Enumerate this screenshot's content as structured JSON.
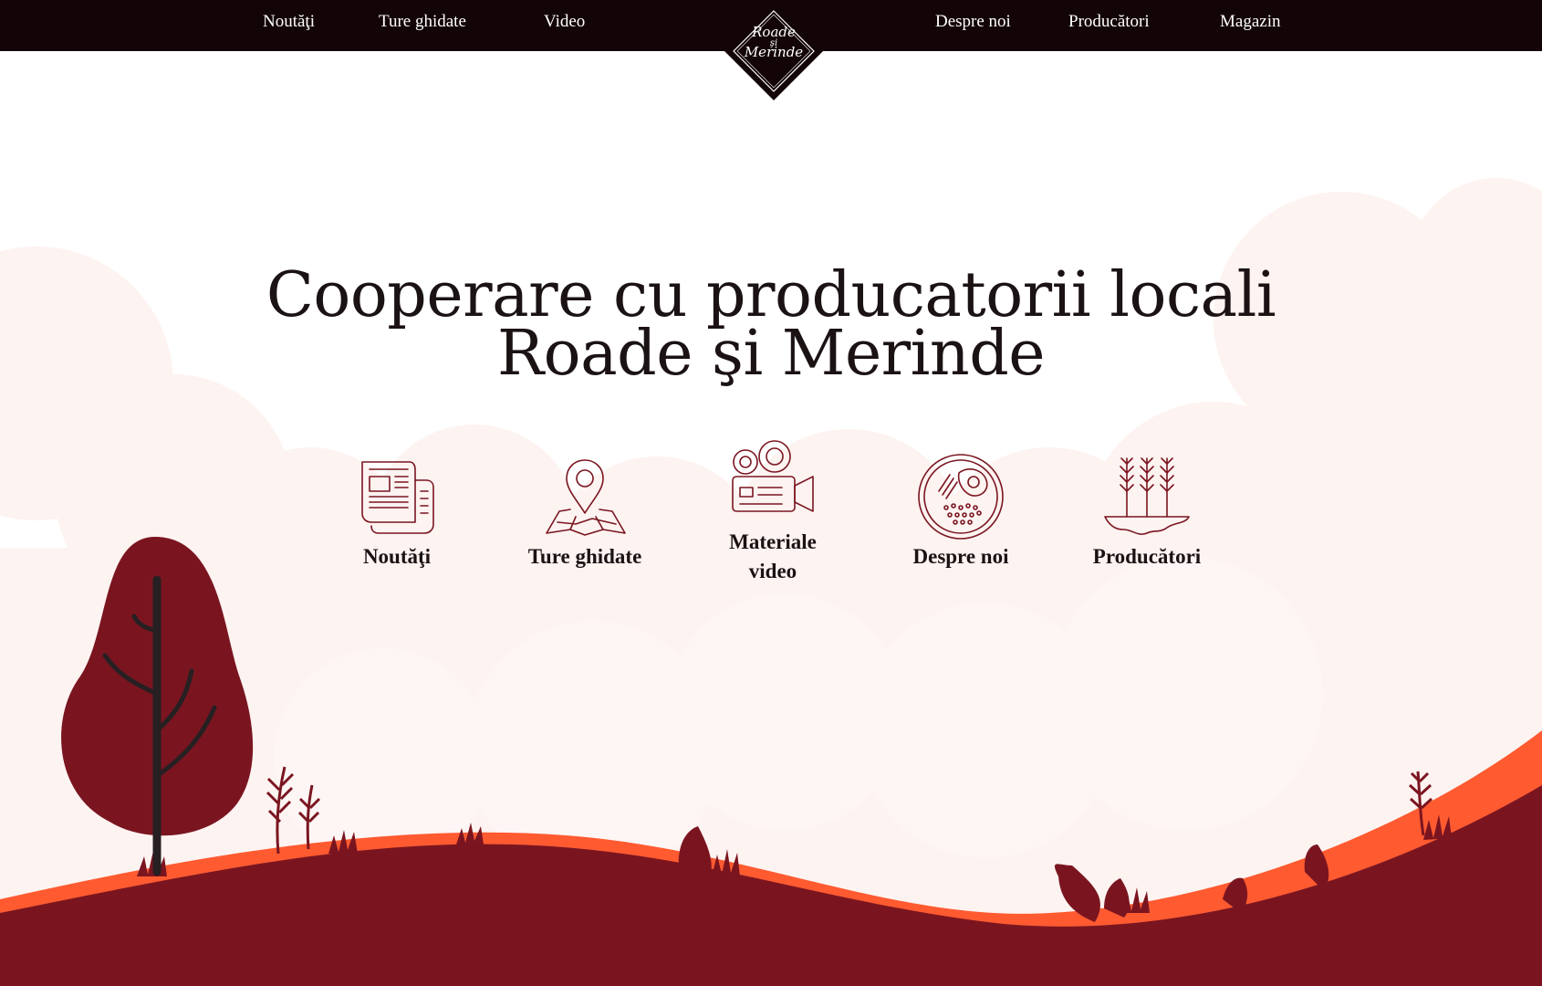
{
  "nav": {
    "left": [
      "Noutăţi",
      "Ture ghidate",
      "Video"
    ],
    "right": [
      "Despre noi",
      "Producători",
      "Magazin"
    ]
  },
  "logo": {
    "line1": "Roade",
    "line2": "şi",
    "line3": "Merinde"
  },
  "hero": {
    "line1": "Cooperare cu producatorii locali",
    "line2": "Roade şi Merinde"
  },
  "features": [
    {
      "label": "Noutăţi",
      "icon": "newspaper-icon"
    },
    {
      "label": "Ture ghidate",
      "icon": "map-pin-icon"
    },
    {
      "label": "Materiale video",
      "icon": "video-camera-icon"
    },
    {
      "label": "Despre noi",
      "icon": "plate-icon"
    },
    {
      "label": "Producători",
      "icon": "wheat-icon"
    }
  ],
  "colors": {
    "nav_bg": "#130507",
    "accent": "#7a1520",
    "ground": "#7a1520",
    "ground_edge": "#ff5a30",
    "cloud": "#fdf1ef",
    "tree_trunk": "#262022",
    "title": "#1b1214"
  }
}
